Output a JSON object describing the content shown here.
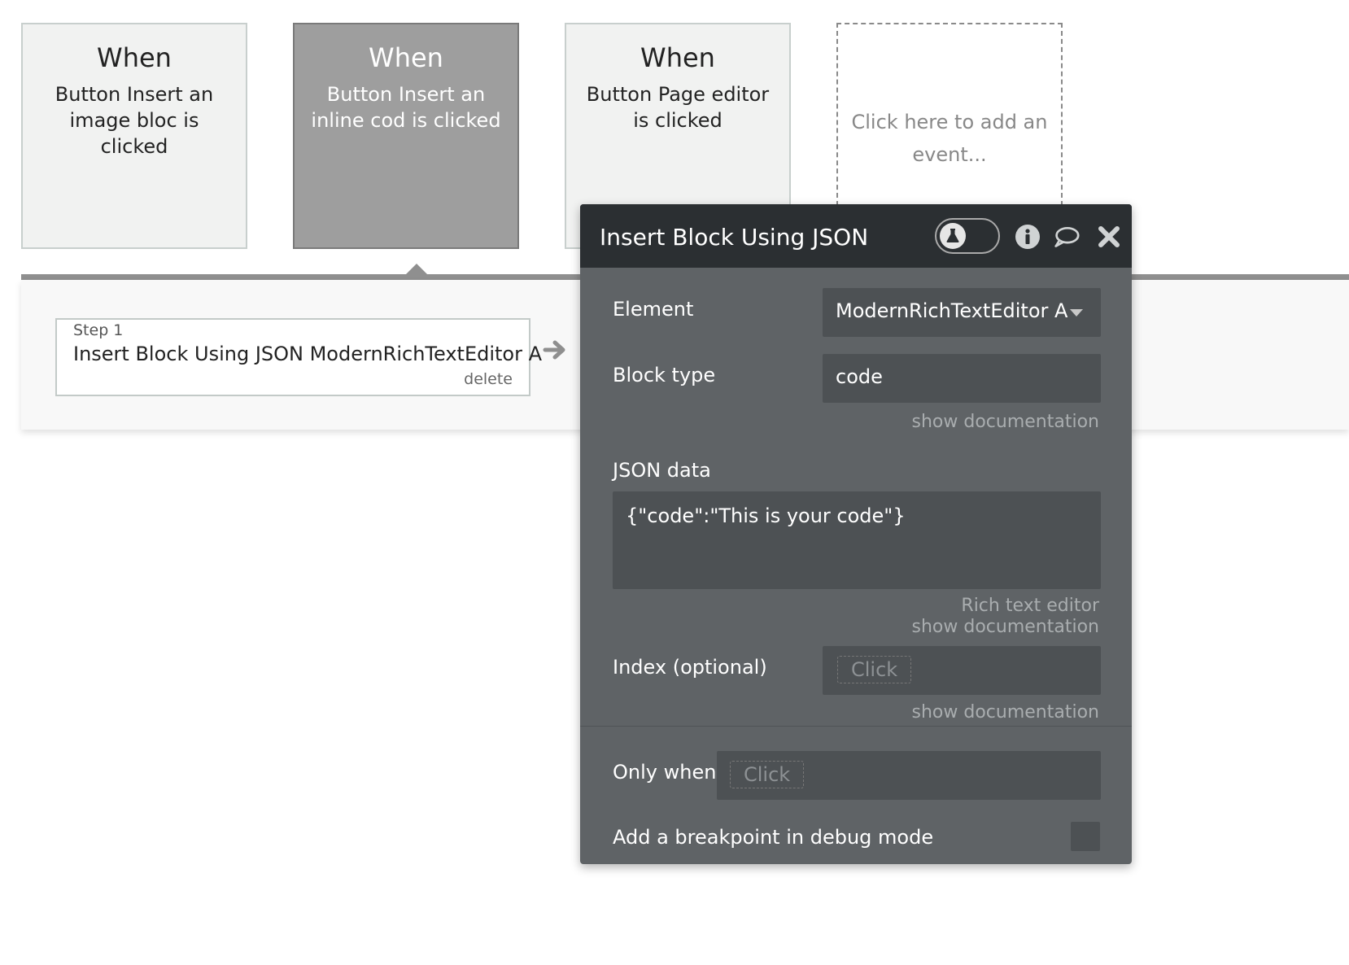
{
  "events": [
    {
      "when": "When",
      "description": "Button Insert an image bloc is clicked"
    },
    {
      "when": "When",
      "description": "Button Insert an inline cod is clicked"
    },
    {
      "when": "When",
      "description": "Button Page editor is clicked"
    }
  ],
  "add_event": {
    "label": "Click here to add an event..."
  },
  "step": {
    "label": "Step 1",
    "title": "Insert Block Using JSON ModernRichTextEditor A",
    "delete_label": "delete"
  },
  "panel": {
    "title": "Insert Block Using JSON",
    "element": {
      "label": "Element",
      "value": "ModernRichTextEditor A"
    },
    "block_type": {
      "label": "Block type",
      "value": "code",
      "doc_link": "show documentation"
    },
    "json_data": {
      "label": "JSON data",
      "value": "{\"code\":\"This is your code\"}",
      "editor_link": "Rich text editor",
      "doc_link": "show documentation"
    },
    "index": {
      "label": "Index (optional)",
      "placeholder": "Click",
      "doc_link": "show documentation"
    },
    "only_when": {
      "label": "Only when",
      "placeholder": "Click"
    },
    "breakpoint": {
      "label": "Add a breakpoint in debug mode",
      "checked": false
    }
  }
}
